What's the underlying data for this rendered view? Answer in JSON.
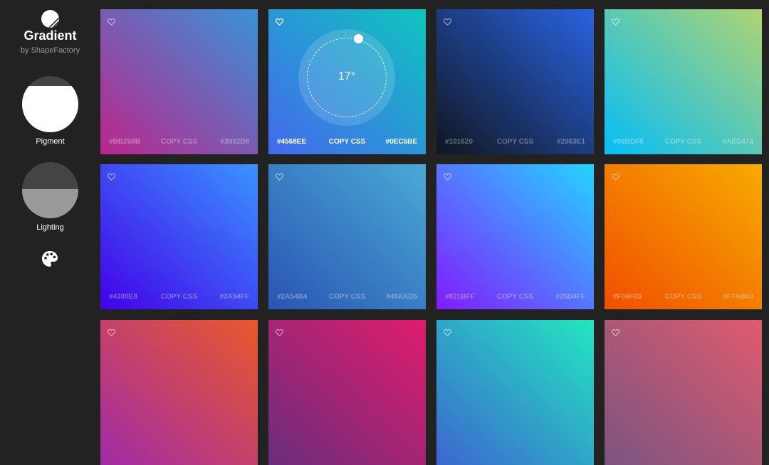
{
  "app": {
    "title": "Gradient",
    "subtitle": "by ShapeFactory"
  },
  "sidebar": {
    "modes": [
      {
        "label": "Pigment"
      },
      {
        "label": "Lighting"
      }
    ],
    "palette_icon": "palette-icon"
  },
  "dial": {
    "temperature": "17°"
  },
  "cards": [
    {
      "c1": "#BB258B",
      "c2": "#3992D8",
      "copy": "COPY CSS",
      "top": "#3992D8",
      "bottom": "#BB258B",
      "dir": "to bottom left",
      "active": false
    },
    {
      "c1": "#4568EE",
      "c2": "#0EC5BE",
      "copy": "COPY CSS",
      "top": "#0EC5BE",
      "bottom": "#4568EE",
      "dir": "to bottom left",
      "active": true
    },
    {
      "c1": "#101620",
      "c2": "#2963E1",
      "copy": "COPY CSS",
      "top": "#2963E1",
      "bottom": "#101620",
      "dir": "to bottom left",
      "active": false
    },
    {
      "c1": "#06BDF8",
      "c2": "#AED473",
      "copy": "COPY CSS",
      "top": "#AED473",
      "bottom": "#06BDF8",
      "dir": "to bottom left",
      "active": false
    },
    {
      "c1": "#4300E8",
      "c2": "#3A94FF",
      "copy": "COPY CSS",
      "top": "#3A94FF",
      "bottom": "#4300E8",
      "dir": "to bottom left",
      "active": false
    },
    {
      "c1": "#2A54B4",
      "c2": "#49AAD5",
      "copy": "COPY CSS",
      "top": "#49AAD5",
      "bottom": "#2A54B4",
      "dir": "to bottom left",
      "active": false
    },
    {
      "c1": "#821BFF",
      "c2": "#25D4FF",
      "copy": "COPY CSS",
      "top": "#25D4FF",
      "bottom": "#821BFF",
      "dir": "to bottom left",
      "active": false
    },
    {
      "c1": "#F04F00",
      "c2": "#F7AB00",
      "copy": "COPY CSS",
      "top": "#F7AB00",
      "bottom": "#F04F00",
      "dir": "to bottom left",
      "active": false
    },
    {
      "top": "#E9582A",
      "bottom": "#A02BA8",
      "dir": "to bottom left",
      "active": false
    },
    {
      "top": "#E01C6C",
      "bottom": "#6A2D7C",
      "dir": "to bottom left",
      "active": false
    },
    {
      "top": "#23E6C0",
      "bottom": "#3C66CF",
      "dir": "to bottom left",
      "active": false
    },
    {
      "top": "#DF5B6E",
      "bottom": "#7A5480",
      "dir": "to bottom left",
      "active": false
    }
  ]
}
